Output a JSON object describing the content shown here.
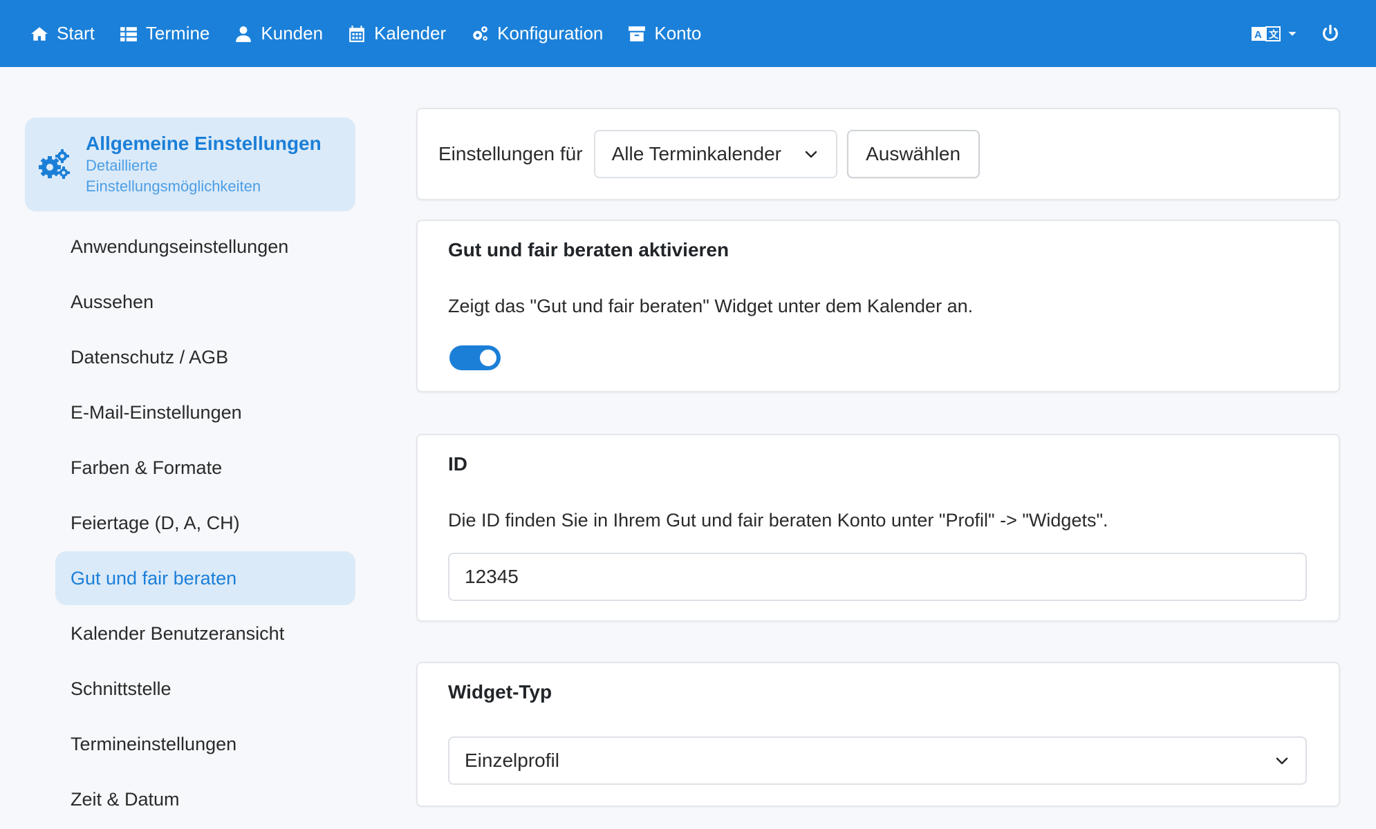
{
  "navbar": {
    "items": [
      {
        "label": "Start",
        "icon": "home-icon"
      },
      {
        "label": "Termine",
        "icon": "list-icon"
      },
      {
        "label": "Kunden",
        "icon": "user-icon"
      },
      {
        "label": "Kalender",
        "icon": "calendar-icon"
      },
      {
        "label": "Konfiguration",
        "icon": "gears-icon"
      },
      {
        "label": "Konto",
        "icon": "archive-icon"
      }
    ],
    "language_icon": "translate-icon",
    "logout_icon": "power-icon",
    "bar_color": "#1b80d9"
  },
  "sidebar": {
    "header": {
      "title": "Allgemeine Einstellungen",
      "subtitle": "Detaillierte Einstellungsmöglichkeiten",
      "icon": "gears-icon"
    },
    "items": [
      {
        "label": "Anwendungseinstellungen",
        "active": false
      },
      {
        "label": "Aussehen",
        "active": false
      },
      {
        "label": "Datenschutz / AGB",
        "active": false
      },
      {
        "label": "E-Mail-Einstellungen",
        "active": false
      },
      {
        "label": "Farben & Formate",
        "active": false
      },
      {
        "label": "Feiertage (D, A, CH)",
        "active": false
      },
      {
        "label": "Gut und fair beraten",
        "active": true
      },
      {
        "label": "Kalender Benutzeransicht",
        "active": false
      },
      {
        "label": "Schnittstelle",
        "active": false
      },
      {
        "label": "Termineinstellungen",
        "active": false
      },
      {
        "label": "Zeit & Datum",
        "active": false
      }
    ]
  },
  "settings_for": {
    "label": "Einstellungen für",
    "dropdown_value": "Alle Terminkalender",
    "button_label": "Auswählen"
  },
  "activate_card": {
    "title": "Gut und fair beraten aktivieren",
    "description": "Zeigt das \"Gut und fair beraten\" Widget unter dem Kalender an.",
    "enabled": true
  },
  "id_card": {
    "title": "ID",
    "description": "Die ID finden Sie in Ihrem Gut und fair beraten Konto unter \"Profil\" -> \"Widgets\".",
    "value": "12345"
  },
  "widget_type_card": {
    "title": "Widget-Typ",
    "selected": "Einzelprofil"
  },
  "colors": {
    "accent": "#1b7fd8",
    "active_bg": "#dbeaf8"
  }
}
